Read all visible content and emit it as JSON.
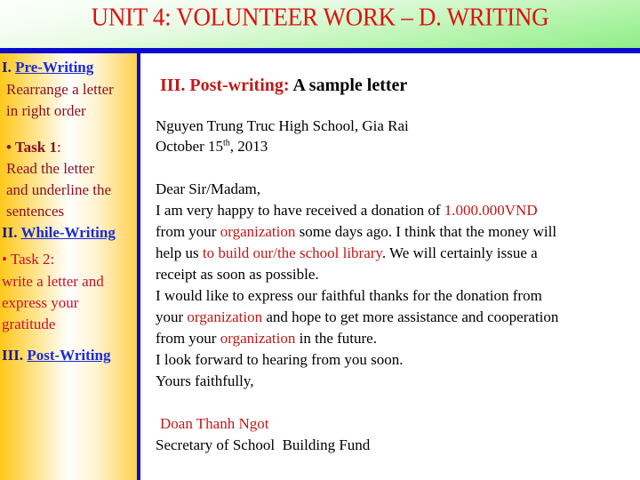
{
  "header": {
    "title": "UNIT 4: VOLUNTEER WORK – D. WRITING"
  },
  "sidebar": {
    "pre_writing": {
      "number": "I.",
      "label": "Pre-Writing",
      "description_line1": "Rearrange a letter",
      "description_line2": "in right order"
    },
    "task1": {
      "bullet": "•",
      "label": "Task 1",
      "colon": ":",
      "line1": "Read the letter",
      "line2": "and underline the",
      "line3": "sentences"
    },
    "while_writing": {
      "number": "II.",
      "label": "While-Writing"
    },
    "task2": {
      "bullet": "•",
      "label": "Task 2:",
      "line1": "write a letter and",
      "line2": "express your",
      "line3": "gratitude"
    },
    "post_writing": {
      "number": "III.",
      "label": "Post-Writing"
    }
  },
  "main": {
    "section_label": "III. Post-writing:",
    "section_subtitle": "A sample letter",
    "address": "Nguyen Trung Truc High School, Gia Rai",
    "date_prefix": "October 15",
    "date_sup": "th",
    "date_suffix": ", 2013",
    "salutation": "Dear Sir/Madam,",
    "letter": {
      "l1_a": "I am very happy to have received a donation of ",
      "l1_red": "1.000.000VND",
      "l2_a": "from your ",
      "l2_red": "organization",
      "l2_b": " some days ago. I think that the money will",
      "l3_a": "help us ",
      "l3_red": "to build our/the school library",
      "l3_b": ". We will certainly issue a",
      "l4": "receipt as soon as possible.",
      "l5": "I would like to express our faithful thanks for the donation from",
      "l6_a": "your ",
      "l6_red": "organization",
      "l6_b": " and hope to get more assistance and cooperation",
      "l7_a": "from your ",
      "l7_red": "organization",
      "l7_b": " in the future.",
      "l8": "I look forward to hearing from you soon.",
      "l9": "Yours faithfully,"
    },
    "signer_name": "Doan Thanh Ngot",
    "signer_title": "Secretary of School  Building Fund"
  },
  "colors": {
    "title_red": "#e01010",
    "accent_blue": "#0a0ad0",
    "highlight_red": "#c21818",
    "sidebar_gold": "#ffc81a",
    "header_green": "#8fee88"
  }
}
